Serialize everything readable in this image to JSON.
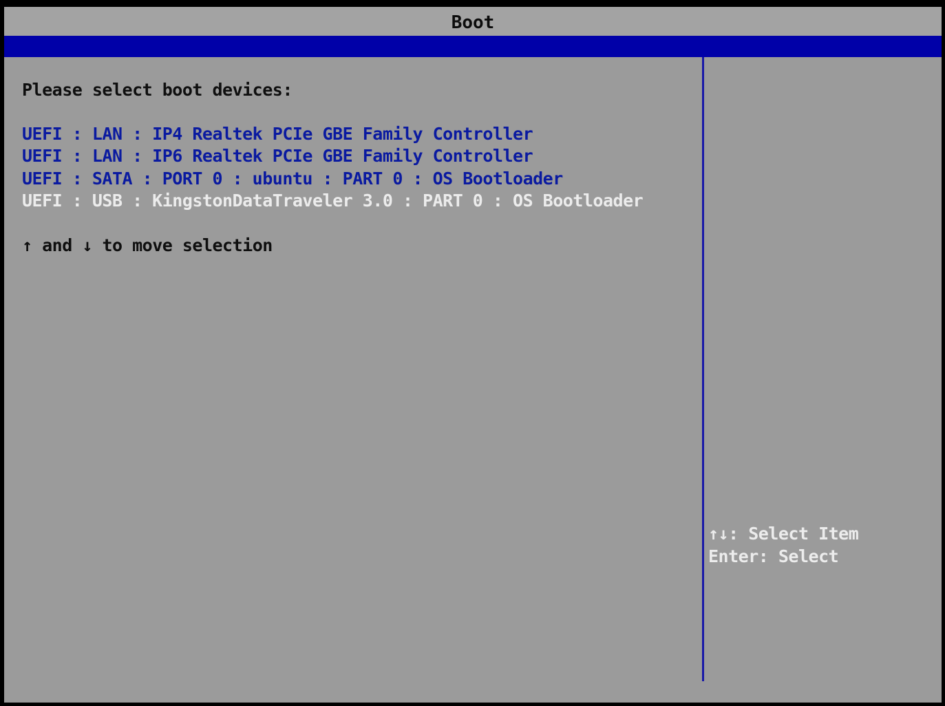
{
  "title": "Boot",
  "prompt": "Please select boot devices:",
  "devices": [
    {
      "label": "UEFI : LAN : IP4 Realtek PCIe GBE Family Controller",
      "selected": false
    },
    {
      "label": "UEFI : LAN : IP6 Realtek PCIe GBE Family Controller",
      "selected": false
    },
    {
      "label": "UEFI : SATA : PORT 0 : ubuntu : PART 0 : OS Bootloader",
      "selected": false
    },
    {
      "label": "UEFI : USB : KingstonDataTraveler 3.0 : PART 0 : OS Bootloader",
      "selected": true
    }
  ],
  "hint": {
    "up_arrow": "↑",
    "and_text": " and ",
    "down_arrow": "↓",
    "rest_text": " to move selection"
  },
  "help": {
    "select_item": "↑↓: Select Item",
    "enter_select": "Enter: Select"
  },
  "colors": {
    "background": "#9b9b9b",
    "title_bar": "#a3a3a3",
    "accent_band": "#0000a8",
    "device_text": "#0a1aa0",
    "highlight_text": "#ececec"
  }
}
